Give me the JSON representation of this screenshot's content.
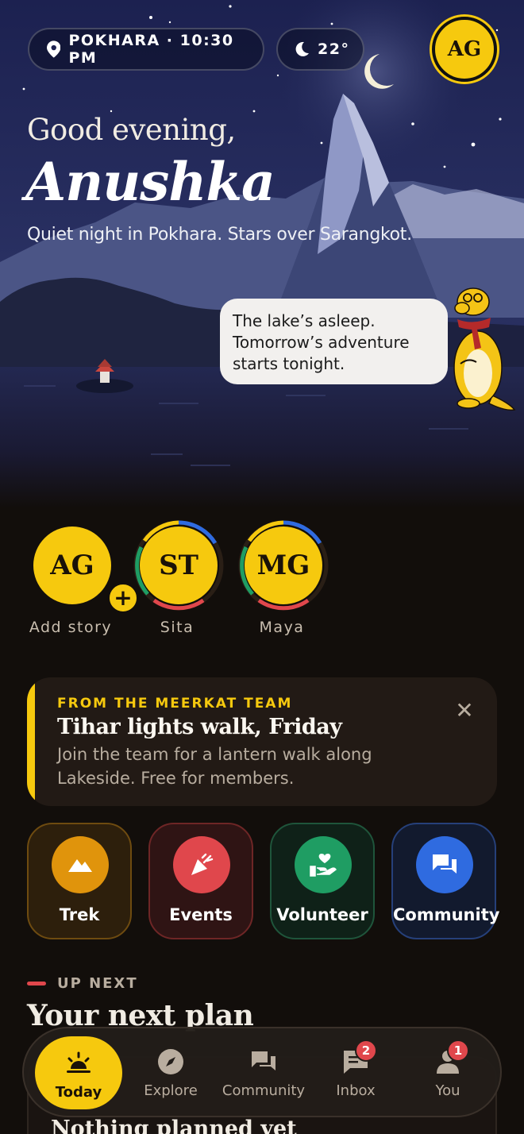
{
  "header": {
    "location_time": "POKHARA · 10:30 PM",
    "temperature": "22°",
    "avatar_initials": "AG"
  },
  "hero": {
    "greeting": "Good evening,",
    "name": "Anushka",
    "subtitle": "Quiet night in Pokhara. Stars over Sarangkot.",
    "speech": "The lake’s asleep. Tomorrow’s adventure starts tonight."
  },
  "stories": [
    {
      "initials": "AG",
      "label": "Add story"
    },
    {
      "initials": "ST",
      "label": "Sita"
    },
    {
      "initials": "MG",
      "label": "Maya"
    }
  ],
  "announcement": {
    "kicker": "FROM THE MEERKAT TEAM",
    "title": "Tihar lights walk, Friday",
    "body": "Join the team for a lantern walk along Lakeside. Free for members."
  },
  "categories": [
    {
      "label": "Trek",
      "icon": "mountain-icon",
      "color": "#e0940c"
    },
    {
      "label": "Events",
      "icon": "party-popper-icon",
      "color": "#e0474c"
    },
    {
      "label": "Volunteer",
      "icon": "heart-hand-icon",
      "color": "#1f9d63"
    },
    {
      "label": "Community",
      "icon": "chat-bubbles-icon",
      "color": "#2f6be0"
    }
  ],
  "up_next": {
    "kicker": "UP NEXT",
    "title": "Your next plan",
    "card_title": "Nothing planned yet"
  },
  "nav": [
    {
      "label": "Today",
      "icon": "sunrise-icon",
      "active": true
    },
    {
      "label": "Explore",
      "icon": "compass-icon"
    },
    {
      "label": "Community",
      "icon": "chat-bubbles-icon"
    },
    {
      "label": "Inbox",
      "icon": "message-icon",
      "badge": "2"
    },
    {
      "label": "You",
      "icon": "person-icon",
      "badge": "1"
    }
  ],
  "colors": {
    "accent": "#f6c90e",
    "alert": "#e0474c",
    "background": "#120e0b"
  }
}
